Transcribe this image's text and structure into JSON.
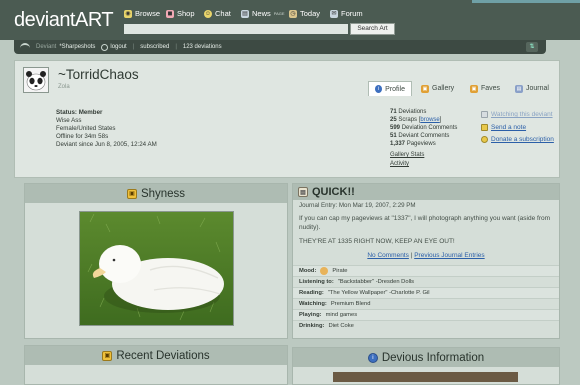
{
  "header": {
    "logo": "deviantART",
    "nav": [
      {
        "label": "Browse",
        "icon": "browse-icon"
      },
      {
        "label": "Shop",
        "icon": "shop-icon"
      },
      {
        "label": "Chat",
        "icon": "chat-icon"
      },
      {
        "label": "News",
        "sup": "PAGE",
        "icon": "news-icon"
      },
      {
        "label": "Today",
        "icon": "today-icon"
      },
      {
        "label": "Forum",
        "icon": "forum-icon"
      }
    ],
    "search_placeholder": "",
    "search_button": "Search Art"
  },
  "subbar": {
    "deviant": "Deviant",
    "user": "*Sharpeshots",
    "logout": "logout",
    "subscribed": "subscribed",
    "deviations": "123 deviations"
  },
  "profile": {
    "username": "~TorridChaos",
    "subname": "Zola",
    "tabs": [
      "Profile",
      "Gallery",
      "Faves",
      "Journal"
    ],
    "info": [
      "Status: Member",
      "Wise Ass",
      "Female/United States",
      "Offline for 34m 58s",
      "Deviant since Jun 8, 2005, 12:24 AM"
    ],
    "stats": [
      {
        "num": "71",
        "label": "Deviations"
      },
      {
        "num": "25",
        "label": "Scraps",
        "extra": "browse"
      },
      {
        "num": "599",
        "label": "Deviation Comments"
      },
      {
        "num": "51",
        "label": "Deviant Comments"
      },
      {
        "num": "1,337",
        "label": "Pageviews"
      }
    ],
    "links": [
      "Gallery Stats",
      "Activity"
    ],
    "actions": [
      "Watching this deviant",
      "Send a note",
      "Donate a subscription"
    ]
  },
  "shyness": {
    "title": "Shyness"
  },
  "journal": {
    "title": "QUICK!!",
    "entry_date": "Journal Entry: Mon Mar 19, 2007, 2:29 PM",
    "text1": "If you can cap my pageviews at \"1337\", I will photograph anything you want (aside from nudity).",
    "text2": "THEY'RE AT 1335 RIGHT NOW, KEEP AN EYE OUT!",
    "no_comments": "No Comments",
    "previous": "Previous Journal Entries",
    "moods": [
      {
        "label": "Mood:",
        "value": "Pirate"
      },
      {
        "label": "Listening to:",
        "value": "\"Backstabber\" -Dresden Dolls"
      },
      {
        "label": "Reading:",
        "value": "\"The Yellow Wallpaper\" -Charlotte P. Gil"
      },
      {
        "label": "Watching:",
        "value": "Premium Blend"
      },
      {
        "label": "Playing:",
        "value": "mind games"
      },
      {
        "label": "Drinking:",
        "value": "Diet Coke"
      }
    ]
  },
  "recent": {
    "title": "Recent Deviations"
  },
  "devious": {
    "title": "Devious Information"
  }
}
